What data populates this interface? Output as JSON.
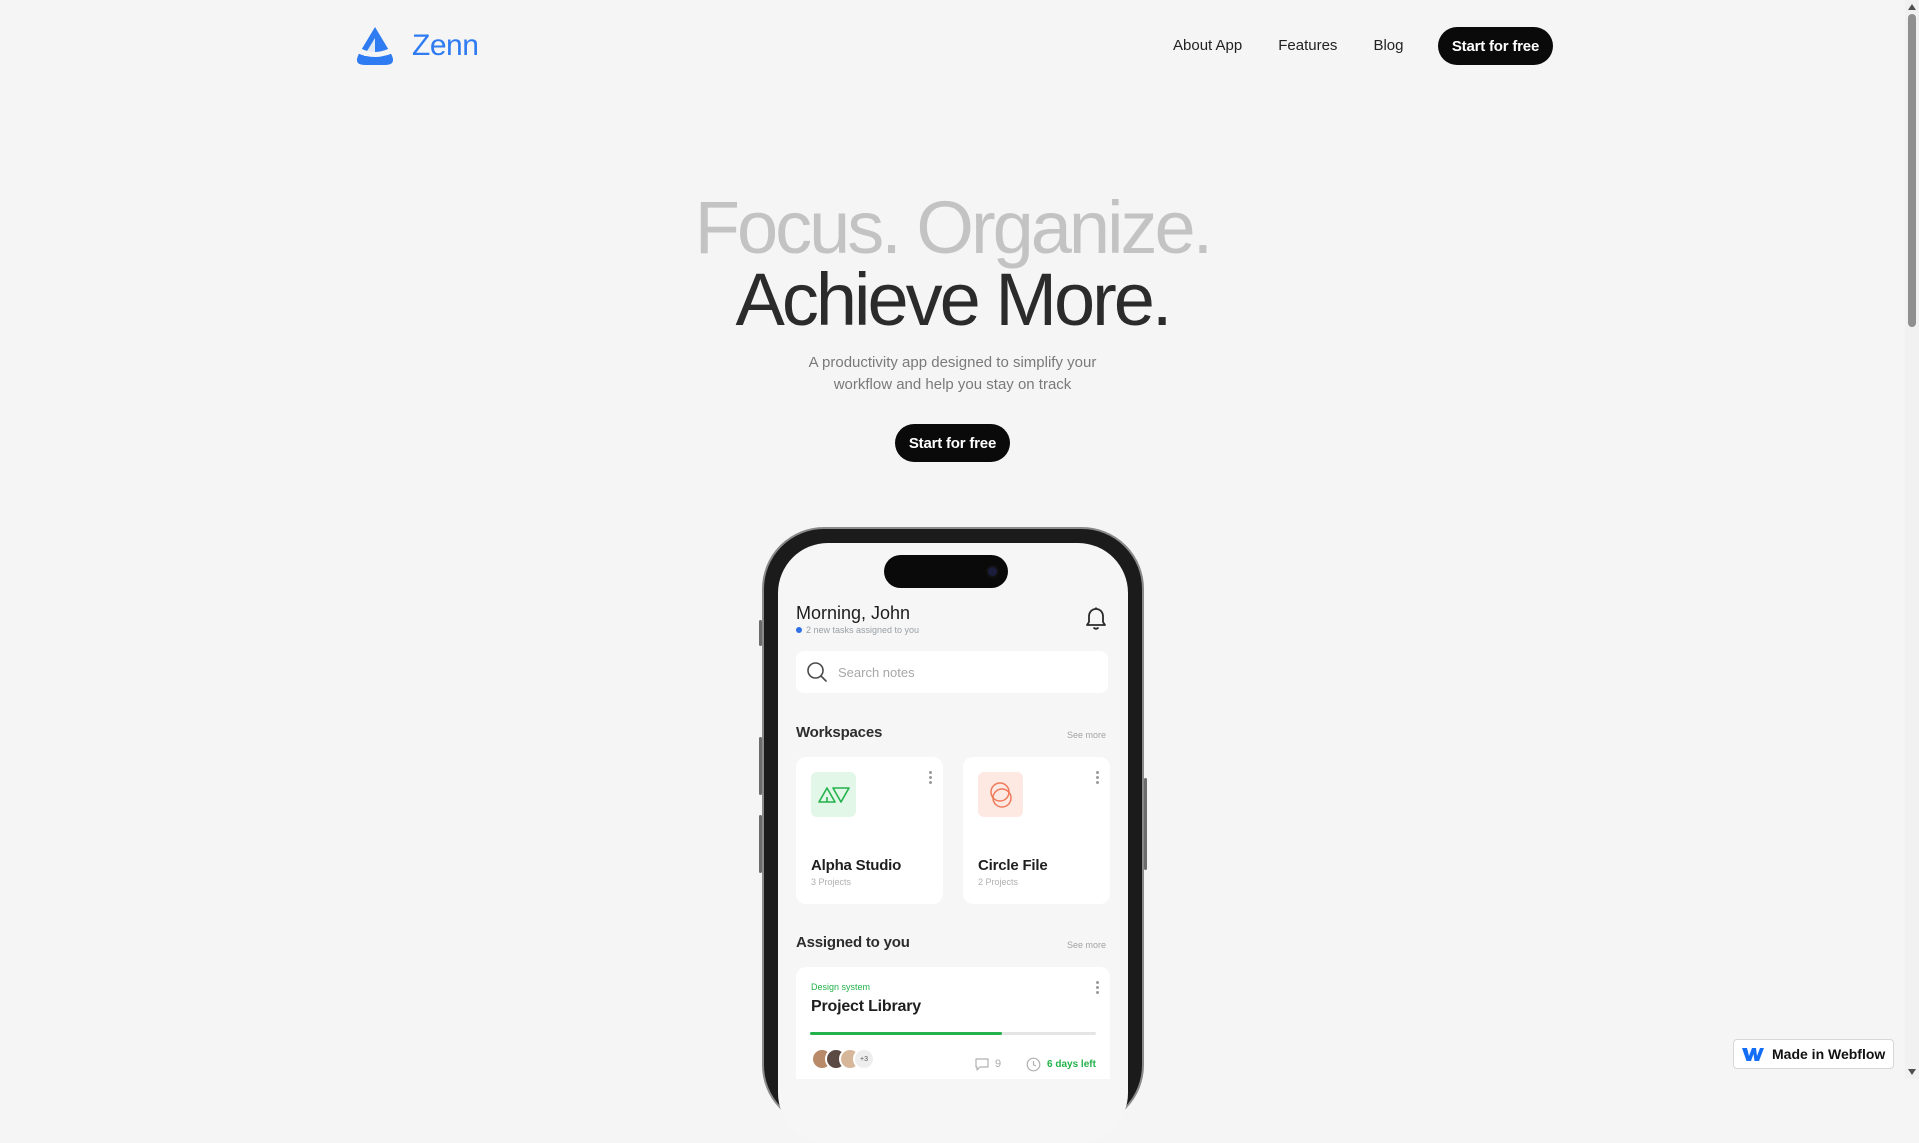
{
  "brand": {
    "name": "Zenn",
    "color": "#2f7bf1",
    "icon": "zenn-logo-icon"
  },
  "nav": {
    "links": [
      "About App",
      "Features",
      "Blog"
    ],
    "cta": "Start for free"
  },
  "hero": {
    "line1": "Focus. Organize.",
    "line2": "Achieve More.",
    "subtitle_line1": "A productivity app designed to simplify your",
    "subtitle_line2": "workflow and help you stay on track",
    "cta": "Start for free"
  },
  "app": {
    "greeting": "Morning, John",
    "notice": "2 new tasks assigned to you",
    "notice_dot_color": "#2f6fe8",
    "search_placeholder": "Search notes",
    "workspaces": {
      "title": "Workspaces",
      "see_more": "See more",
      "items": [
        {
          "name": "Alpha Studio",
          "count": "3 Projects",
          "icon": "alpha-studio-logo-icon",
          "accent": "#23b24b"
        },
        {
          "name": "Circle File",
          "count": "2 Projects",
          "icon": "circle-file-logo-icon",
          "accent": "#ef7a59"
        }
      ]
    },
    "assigned": {
      "title": "Assigned to you",
      "see_more": "See more",
      "task": {
        "category": "Design system",
        "name": "Project Library",
        "progress": 0.67,
        "progress_color": "#23b24b",
        "avatars_extra": "+3",
        "comments": "9",
        "deadline": "6 days left"
      }
    }
  },
  "badge": {
    "label": "Made in Webflow",
    "color": "#146ef5"
  }
}
